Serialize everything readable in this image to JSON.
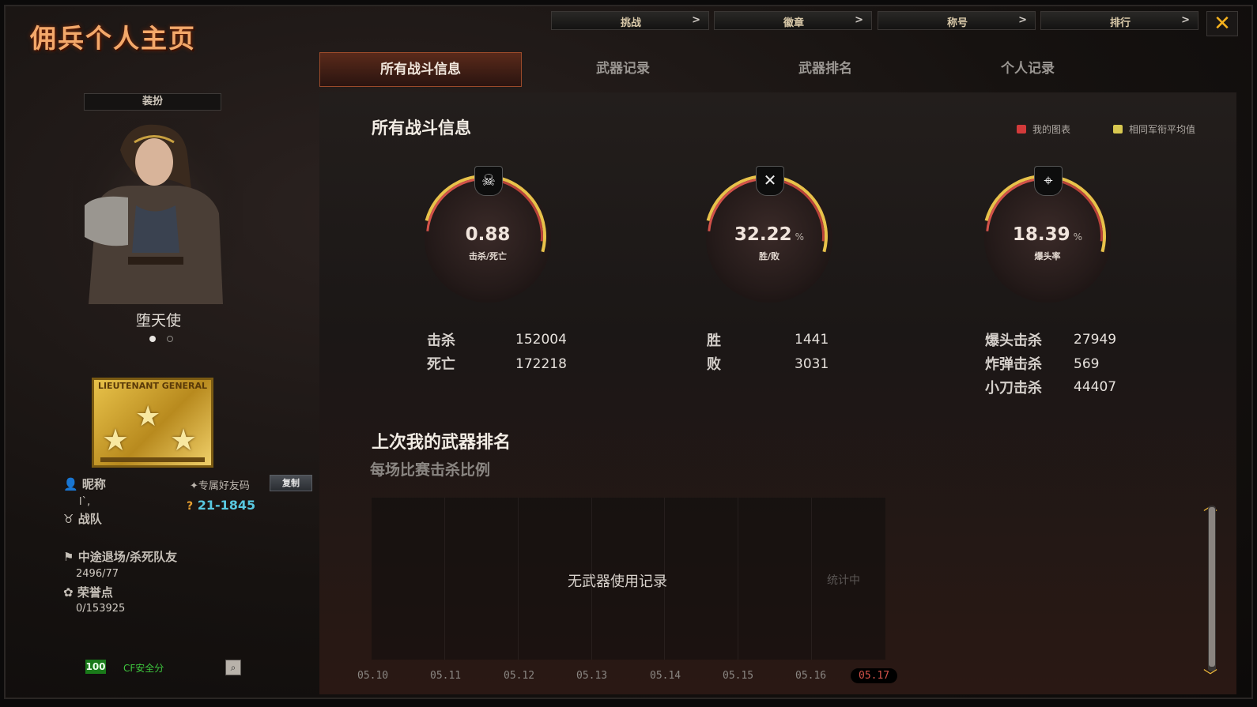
{
  "window": {
    "title": "佣兵个人主页",
    "close_label": "✕"
  },
  "top_buttons": [
    {
      "label": "挑战",
      "chevron": ">"
    },
    {
      "label": "徽章",
      "chevron": ">"
    },
    {
      "label": "称号",
      "chevron": ">"
    },
    {
      "label": "排行",
      "chevron": ">"
    }
  ],
  "tabs": [
    {
      "label": "所有战斗信息",
      "active": true
    },
    {
      "label": "武器记录",
      "active": false
    },
    {
      "label": "武器排名",
      "active": false
    },
    {
      "label": "个人记录",
      "active": false
    }
  ],
  "section": {
    "title": "所有战斗信息",
    "legend": [
      {
        "label": "我的图表",
        "color": "#d23a3a"
      },
      {
        "label": "相同军衔平均值",
        "color": "#d8c850"
      }
    ]
  },
  "gauges": [
    {
      "value": "0.88",
      "unit": "",
      "label": "击杀/死亡",
      "icon": "skull-icon",
      "glyph": "☠"
    },
    {
      "value": "32.22",
      "unit": "%",
      "label": "胜/败",
      "icon": "crossed-guns-icon",
      "glyph": "✕"
    },
    {
      "value": "18.39",
      "unit": "%",
      "label": "爆头率",
      "icon": "crosshair-icon",
      "glyph": "⌖"
    }
  ],
  "stats": {
    "kills_label": "击杀",
    "kills": "152004",
    "deaths_label": "死亡",
    "deaths": "172218",
    "wins_label": "胜",
    "wins": "1441",
    "losses_label": "败",
    "losses": "3031",
    "headshot_label": "爆头击杀",
    "headshot": "27949",
    "grenade_label": "炸弹击杀",
    "grenade": "569",
    "knife_label": "小刀击杀",
    "knife": "44407"
  },
  "weapon_rank": {
    "title": "上次我的武器排名",
    "subtitle": "每场比赛击杀比例",
    "empty_text": "无武器使用记录",
    "counting_text": "统计中",
    "dates": [
      "05.10",
      "05.11",
      "05.12",
      "05.13",
      "05.14",
      "05.15",
      "05.16",
      "05.17"
    ],
    "selected_date": "05.17"
  },
  "profile": {
    "dress_button": "装扮",
    "character_name": "堕天使",
    "rank_text": "LIEUTENANT GENERAL",
    "nickname_label": "昵称",
    "nickname_value": "l`,",
    "friend_code_label": "专属好友码",
    "copy_button": "复制",
    "friend_code": "21-1845",
    "clan_label": "战队",
    "quit_label": "中途退场/杀死队友",
    "quit_value": "2496/77",
    "honor_label": "荣誉点",
    "honor_value": "0/153925",
    "safe_score": "100",
    "safe_label": "CF安全分"
  }
}
